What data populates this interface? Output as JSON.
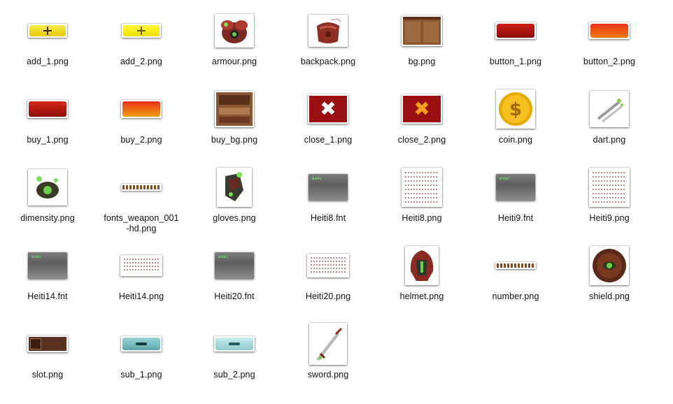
{
  "files": [
    {
      "name": "add_1.png",
      "icon": "add-icon"
    },
    {
      "name": "add_2.png",
      "icon": "add-icon"
    },
    {
      "name": "armour.png",
      "icon": "armour-icon"
    },
    {
      "name": "backpack.png",
      "icon": "backpack-icon"
    },
    {
      "name": "bg.png",
      "icon": "background-icon"
    },
    {
      "name": "button_1.png",
      "icon": "button-icon"
    },
    {
      "name": "button_2.png",
      "icon": "button-icon"
    },
    {
      "name": "buy_1.png",
      "icon": "buy-button-icon"
    },
    {
      "name": "buy_2.png",
      "icon": "buy-button-icon"
    },
    {
      "name": "buy_bg.png",
      "icon": "buy-background-icon"
    },
    {
      "name": "close_1.png",
      "icon": "close-icon"
    },
    {
      "name": "close_2.png",
      "icon": "close-icon"
    },
    {
      "name": "coin.png",
      "icon": "coin-icon"
    },
    {
      "name": "dart.png",
      "icon": "dart-icon"
    },
    {
      "name": "dimensity.png",
      "icon": "dimensity-icon"
    },
    {
      "name": "fonts_weapon_001\n-hd.png",
      "icon": "font-strip-icon"
    },
    {
      "name": "gloves.png",
      "icon": "gloves-icon"
    },
    {
      "name": "Heiti8.fnt",
      "icon": "fnt-file-icon"
    },
    {
      "name": "Heiti8.png",
      "icon": "font-sheet-icon"
    },
    {
      "name": "Heiti9.fnt",
      "icon": "fnt-file-icon"
    },
    {
      "name": "Heiti9.png",
      "icon": "font-sheet-icon"
    },
    {
      "name": "Heiti14.fnt",
      "icon": "fnt-file-icon"
    },
    {
      "name": "Heiti14.png",
      "icon": "font-sheet-icon"
    },
    {
      "name": "Heiti20.fnt",
      "icon": "fnt-file-icon"
    },
    {
      "name": "Heiti20.png",
      "icon": "font-sheet-icon"
    },
    {
      "name": "helmet.png",
      "icon": "helmet-icon"
    },
    {
      "name": "number.png",
      "icon": "number-strip-icon"
    },
    {
      "name": "shield.png",
      "icon": "shield-icon"
    },
    {
      "name": "slot.png",
      "icon": "slot-icon"
    },
    {
      "name": "sub_1.png",
      "icon": "subtract-icon"
    },
    {
      "name": "sub_2.png",
      "icon": "subtract-icon"
    },
    {
      "name": "sword.png",
      "icon": "sword-icon"
    }
  ],
  "fnt_badge": "exec",
  "colors": {
    "yellow": "#f5e21a",
    "red": "#b0100a",
    "orange": "#f05a10",
    "teal": "#7fc2c4",
    "brown": "#6b4026",
    "gold": "#f0b400"
  }
}
